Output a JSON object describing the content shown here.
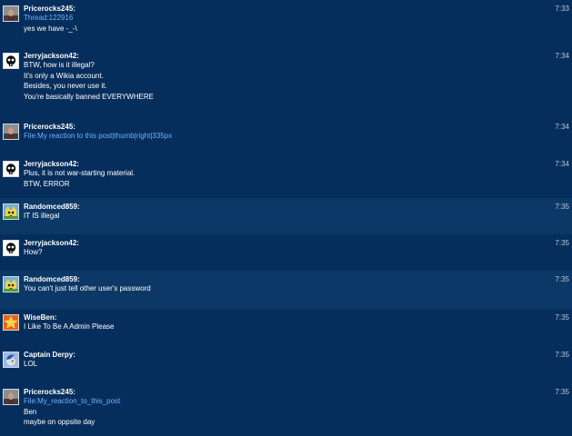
{
  "messages": [
    {
      "user": "Pricerocks245:",
      "time": "7:33",
      "avatar": "photo-avatar-icon",
      "lines": [
        {
          "text": "Thread:122916",
          "link": true
        },
        {
          "text": "yes we have -_-\\",
          "link": false
        }
      ]
    },
    {
      "user": "Jerryjackson42:",
      "time": "7:34",
      "avatar": "skull-avatar-icon",
      "lines": [
        {
          "text": "BTW, how is it illegal?",
          "link": false
        },
        {
          "text": "It's only a Wikia account.",
          "link": false
        },
        {
          "text": "Besides, you never use it.",
          "link": false
        },
        {
          "text": "You're basically banned EVERYWHERE",
          "link": false
        }
      ]
    },
    {
      "user": "Pricerocks245:",
      "time": "7:34",
      "avatar": "photo-avatar-icon",
      "lines": [
        {
          "text": "File:My reaction to this post|thumb|right|335px",
          "link": true
        }
      ]
    },
    {
      "user": "Jerryjackson42:",
      "time": "7:34",
      "avatar": "skull-avatar-icon",
      "lines": [
        {
          "text": "Plus, it is not war-starting material.",
          "link": false
        },
        {
          "text": "BTW, ERROR",
          "link": false
        }
      ]
    },
    {
      "user": "Randomced859:",
      "time": "7:35",
      "avatar": "cat-avatar-icon",
      "lines": [
        {
          "text": "IT IS illegal",
          "link": false
        }
      ]
    },
    {
      "user": "Jerryjackson42:",
      "time": "7:35",
      "avatar": "skull-avatar-icon",
      "lines": [
        {
          "text": "How?",
          "link": false
        }
      ]
    },
    {
      "user": "Randomced859:",
      "time": "7:35",
      "avatar": "cat-avatar-icon",
      "lines": [
        {
          "text": "You can't just tell other user's password",
          "link": false
        }
      ]
    },
    {
      "user": "WiseBen:",
      "time": "7:35",
      "avatar": "star-avatar-icon",
      "lines": [
        {
          "text": "I Like To Be A Admin Please",
          "link": false
        }
      ]
    },
    {
      "user": "Captain Derpy:",
      "time": "7:35",
      "avatar": "pony-avatar-icon",
      "lines": [
        {
          "text": "LOL",
          "link": false
        }
      ]
    },
    {
      "user": "Pricerocks245:",
      "time": "7:35",
      "avatar": "photo-avatar-icon",
      "lines": [
        {
          "text": "File:My_reaction_to_this_post",
          "link": true
        },
        {
          "text": "Ben",
          "link": false
        },
        {
          "text": "maybe on oppsite day",
          "link": false
        }
      ]
    }
  ]
}
